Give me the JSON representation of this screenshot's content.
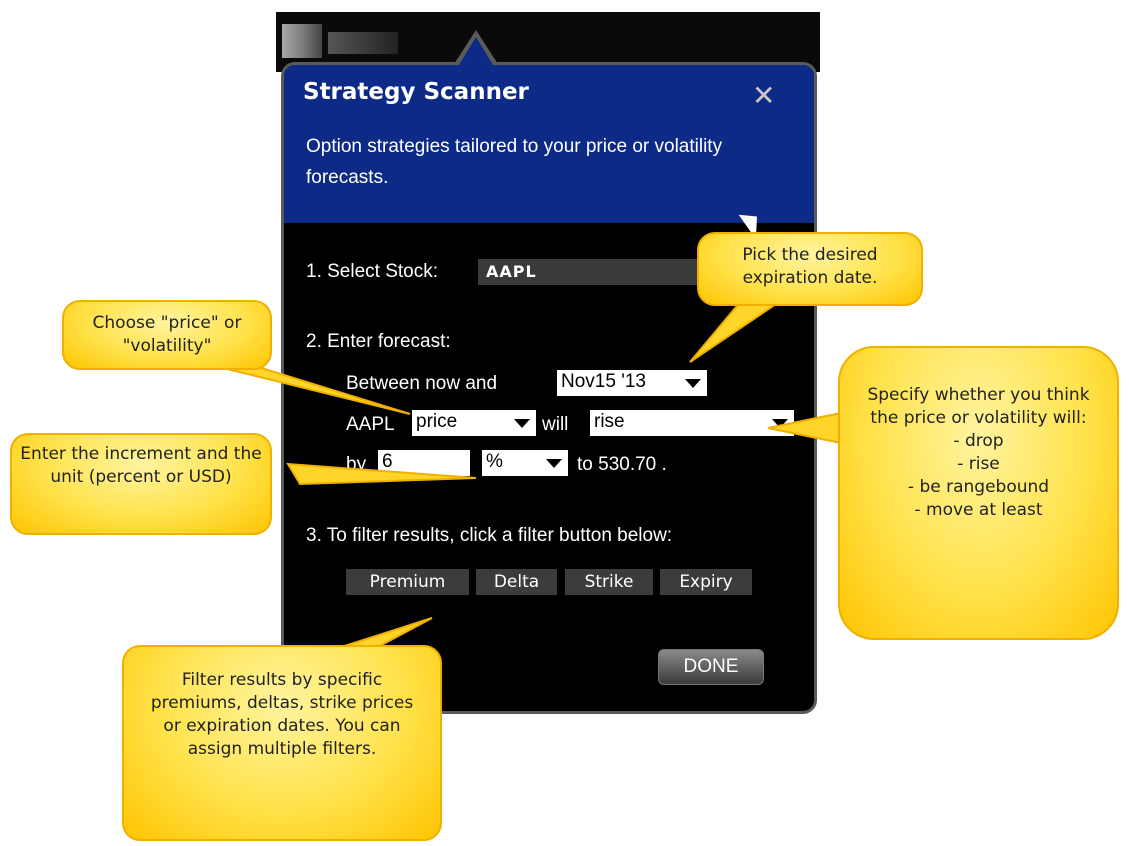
{
  "dialog": {
    "title": "Strategy Scanner",
    "close_glyph": "✕",
    "subtitle": "Option strategies tailored to your price or volatility forecasts.",
    "step1": {
      "label": "1. Select Stock:",
      "stock": "AAPL"
    },
    "step2": {
      "label": "2. Enter forecast:",
      "between_text": "Between  now  and",
      "date_value": "Nov15 '13",
      "symbol": "AAPL",
      "metric_value": "price",
      "will_text": "will",
      "direction_value": "rise",
      "by_text": "by",
      "increment_value": "6",
      "unit_value": "%",
      "target_text": "to 530.70 ."
    },
    "step3": {
      "label": "3. To filter results, click a filter button below:",
      "filters": [
        "Premium",
        "Delta",
        "Strike",
        "Expiry"
      ]
    },
    "done_label": "DONE"
  },
  "callouts": {
    "expiration": "Pick the desired expiration date.",
    "metric": "Choose \"price\" or \"volatility\"",
    "increment": "Enter the increment and the unit (percent or USD)",
    "direction": [
      "Specify whether you think the price or volatility will:",
      "- drop",
      "- rise",
      "- be rangebound",
      "- move at least"
    ],
    "filters": "Filter results by specific premiums, deltas, strike prices or expiration dates. You can assign multiple filters."
  },
  "colors": {
    "header_bg": "#0c2a86",
    "dialog_bg": "#000000",
    "callout_fill": "#ffe24a",
    "callout_border": "#f0b000"
  }
}
